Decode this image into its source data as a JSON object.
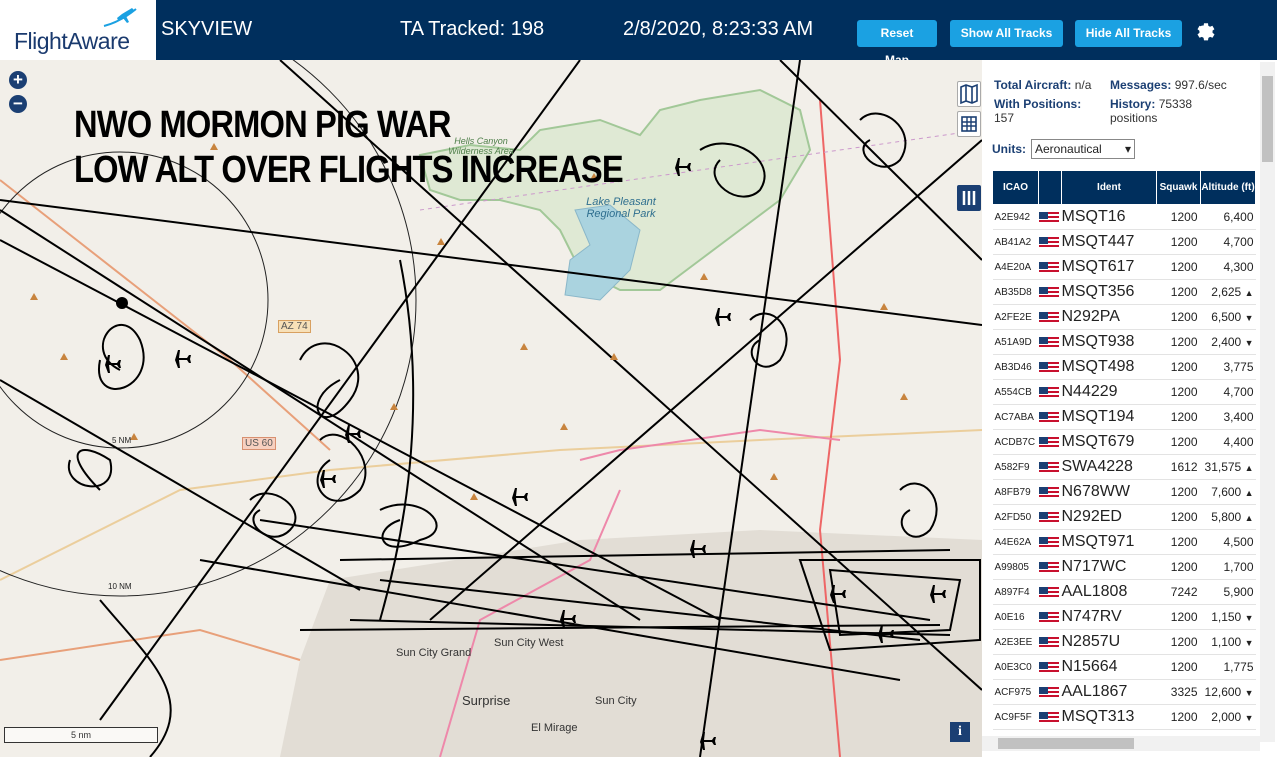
{
  "header": {
    "brand": "FlightAware",
    "app_name": "SKYVIEW",
    "ta_tracked": "TA Tracked: 198",
    "datetime": "2/8/2020, 8:23:33 AM",
    "reset_label": "Reset Map",
    "show_label": "Show All Tracks",
    "hide_label": "Hide All Tracks"
  },
  "map": {
    "overlay_line1": "NWO MORMON PIG WAR",
    "overlay_line2": "LOW ALT OVER FLIGHTS INCREASE",
    "zoom_in": "+",
    "zoom_out": "−",
    "scale_label": "5 nm",
    "info": "i",
    "places": {
      "hells_canyon": "Hells Canyon Wilderness Area",
      "lake_pleasant": "Lake Pleasant Regional Park",
      "sun_city_grand": "Sun City Grand",
      "sun_city_west": "Sun City West",
      "surprise": "Surprise",
      "sun_city": "Sun City",
      "el_mirage": "El Mirage"
    },
    "roads": {
      "az74": "AZ 74",
      "us60": "US 60"
    },
    "range_rings": {
      "r5": "5 NM",
      "r10": "10 NM"
    }
  },
  "sidebar": {
    "total_aircraft_label": "Total Aircraft:",
    "total_aircraft_value": "n/a",
    "messages_label": "Messages:",
    "messages_value": "997.6/sec",
    "with_positions_label": "With Positions:",
    "with_positions_value": "157",
    "history_label": "History:",
    "history_value": "75338 positions",
    "units_label": "Units:",
    "units_value": "Aeronautical",
    "columns": {
      "icao": "ICAO",
      "ident": "Ident",
      "squawk": "Squawk",
      "altitude": "Altitude (ft)"
    },
    "rows": [
      {
        "icao": "A2E942",
        "ident": "MSQT16",
        "squawk": "1200",
        "alt": "6,400",
        "trend": ""
      },
      {
        "icao": "AB41A2",
        "ident": "MSQT447",
        "squawk": "1200",
        "alt": "4,700",
        "trend": ""
      },
      {
        "icao": "A4E20A",
        "ident": "MSQT617",
        "squawk": "1200",
        "alt": "4,300",
        "trend": ""
      },
      {
        "icao": "AB35D8",
        "ident": "MSQT356",
        "squawk": "1200",
        "alt": "2,625",
        "trend": "▲"
      },
      {
        "icao": "A2FE2E",
        "ident": "N292PA",
        "squawk": "1200",
        "alt": "6,500",
        "trend": "▼"
      },
      {
        "icao": "A51A9D",
        "ident": "MSQT938",
        "squawk": "1200",
        "alt": "2,400",
        "trend": "▼"
      },
      {
        "icao": "AB3D46",
        "ident": "MSQT498",
        "squawk": "1200",
        "alt": "3,775",
        "trend": ""
      },
      {
        "icao": "A554CB",
        "ident": "N44229",
        "squawk": "1200",
        "alt": "4,700",
        "trend": ""
      },
      {
        "icao": "AC7ABA",
        "ident": "MSQT194",
        "squawk": "1200",
        "alt": "3,400",
        "trend": ""
      },
      {
        "icao": "ACDB7C",
        "ident": "MSQT679",
        "squawk": "1200",
        "alt": "4,400",
        "trend": ""
      },
      {
        "icao": "A582F9",
        "ident": "SWA4228",
        "squawk": "1612",
        "alt": "31,575",
        "trend": "▲"
      },
      {
        "icao": "A8FB79",
        "ident": "N678WW",
        "squawk": "1200",
        "alt": "7,600",
        "trend": "▲"
      },
      {
        "icao": "A2FD50",
        "ident": "N292ED",
        "squawk": "1200",
        "alt": "5,800",
        "trend": "▲"
      },
      {
        "icao": "A4E62A",
        "ident": "MSQT971",
        "squawk": "1200",
        "alt": "4,500",
        "trend": ""
      },
      {
        "icao": "A99805",
        "ident": "N717WC",
        "squawk": "1200",
        "alt": "1,700",
        "trend": ""
      },
      {
        "icao": "A897F4",
        "ident": "AAL1808",
        "squawk": "7242",
        "alt": "5,900",
        "trend": ""
      },
      {
        "icao": "A0E16",
        "ident": "N747RV",
        "squawk": "1200",
        "alt": "1,150",
        "trend": "▼"
      },
      {
        "icao": "A2E3EE",
        "ident": "N2857U",
        "squawk": "1200",
        "alt": "1,100",
        "trend": "▼"
      },
      {
        "icao": "A0E3C0",
        "ident": "N15664",
        "squawk": "1200",
        "alt": "1,775",
        "trend": ""
      },
      {
        "icao": "ACF975",
        "ident": "AAL1867",
        "squawk": "3325",
        "alt": "12,600",
        "trend": "▼"
      },
      {
        "icao": "AC9F5F",
        "ident": "MSQT313",
        "squawk": "1200",
        "alt": "2,000",
        "trend": "▼"
      }
    ]
  },
  "colors": {
    "header_bg": "#002f5d",
    "button_bg": "#1ba1e2",
    "map_land": "#f2efe9",
    "water": "#aad3df",
    "track": "#000000"
  },
  "icons": {
    "gear": "gear-icon",
    "layers": "map-layers-icon",
    "grid": "grid-icon",
    "columns": "columns-icon",
    "plane": "airplane-icon"
  }
}
